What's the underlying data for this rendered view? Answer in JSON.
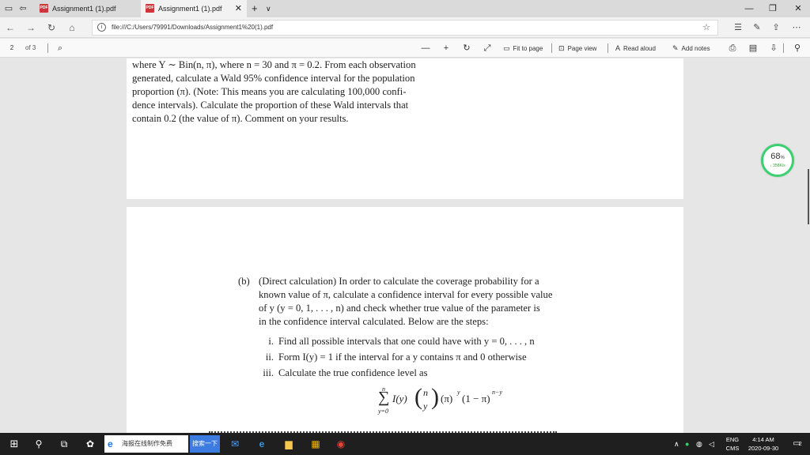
{
  "browser": {
    "tabs": [
      {
        "label": "Assignment1 (1).pdf",
        "active": false
      },
      {
        "label": "Assignment1 (1).pdf",
        "active": true
      }
    ],
    "address": "file:///C:/Users/79991/Downloads/Assignment1%20(1).pdf",
    "window_controls": {
      "minimize": "—",
      "restore": "❐",
      "close": "✕"
    }
  },
  "pdf_toolbar": {
    "page_current": "2",
    "page_total": "of 3",
    "zoom_out": "—",
    "zoom_in": "+",
    "fit_to_page": "Fit to page",
    "page_view": "Page view",
    "read_aloud": "Read aloud",
    "add_notes": "Add notes"
  },
  "document": {
    "page1_lines": [
      "where Y ∼ Bin(n, π), where n = 30 and π = 0.2. From each observation",
      "generated, calculate a Wald 95% confidence interval for the population",
      "proportion (π). (Note: This means you are calculating 100,000 confi-",
      "dence intervals). Calculate the proportion of these Wald intervals that",
      "contain 0.2 (the value of π). Comment on your results."
    ],
    "part_b_label": "(b)",
    "part_b_lines": [
      "(Direct calculation) In order to calculate the coverage probability for a",
      "known value of π, calculate a confidence interval for every possible value",
      "of y (y = 0, 1, . . . , n) and check whether true value of the parameter is",
      "in the confidence interval calculated. Below are the steps:"
    ],
    "steps": [
      {
        "num": "i.",
        "text": "Find all possible intervals that one could have with y = 0, . . . , n"
      },
      {
        "num": "ii.",
        "text": "Form I(y) = 1 if the interval for a y contains π and 0 otherwise"
      },
      {
        "num": "iii.",
        "text": "Calculate the true confidence level as"
      }
    ],
    "formula_sum_top": "n",
    "formula_sum_bottom": "y=0",
    "formula_body": "I(y)",
    "formula_binom_top": "n",
    "formula_binom_bottom": "y",
    "formula_tail": "(π)",
    "formula_exp1": "y",
    "formula_tail2": "(1 − π)",
    "formula_exp2": "n−y"
  },
  "perf_widget": {
    "percent": "68",
    "unit": "%",
    "speed": "↓ 358K/s"
  },
  "taskbar": {
    "search_text": "海报在线制作免费",
    "search_button": "搜索一下",
    "tray_lang": "ENG",
    "tray_ime": "CMS",
    "time": "4:14 AM",
    "date": "2020-09-30",
    "notifications": "2"
  },
  "colors": {
    "accent_green": "#3bd170",
    "pdf_red": "#d13438",
    "taskbar_bg": "#1f1f1f"
  }
}
